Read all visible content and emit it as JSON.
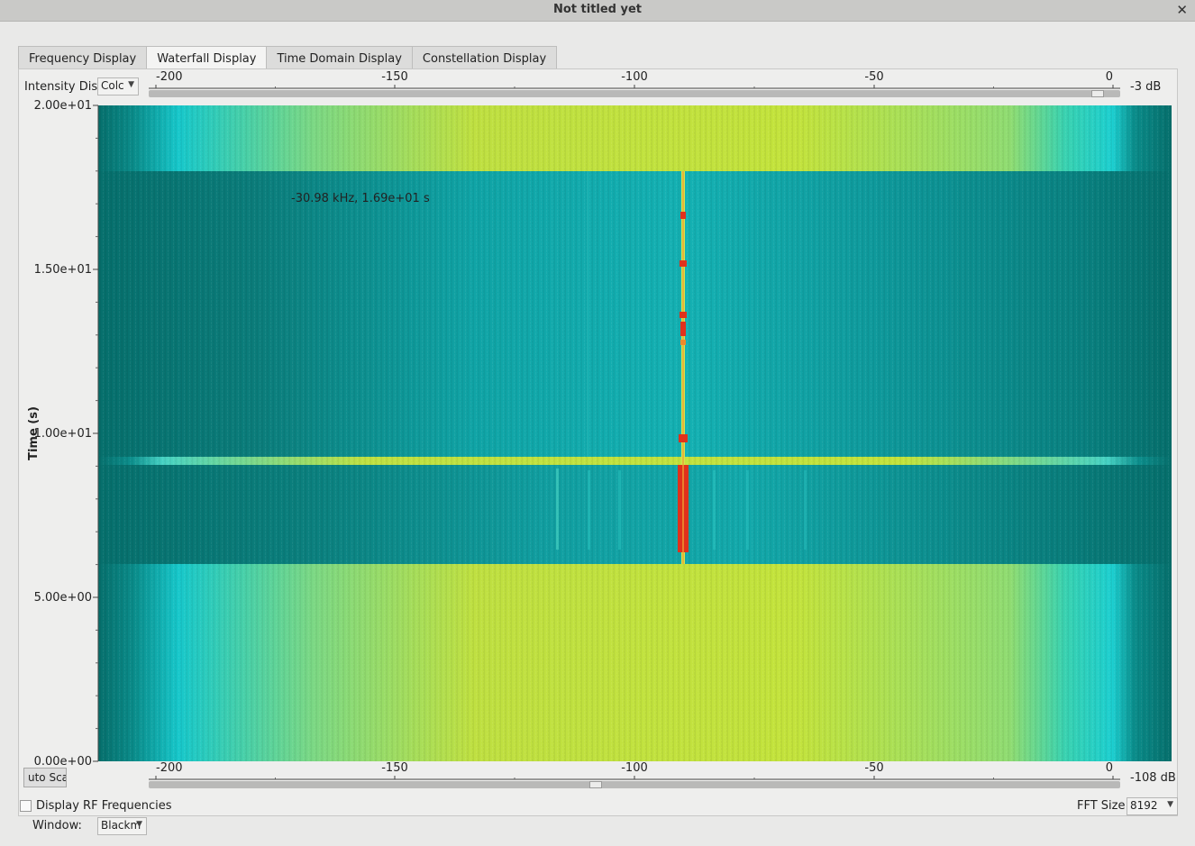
{
  "window": {
    "title": "Not titled yet"
  },
  "tabs": [
    {
      "label": "Frequency Display"
    },
    {
      "label": "Waterfall Display"
    },
    {
      "label": "Time Domain Display"
    },
    {
      "label": "Constellation Display"
    }
  ],
  "toolbar": {
    "intensity_label": "Intensity Disp",
    "intensity_combo": "Colc",
    "max_db": "-3 dB",
    "min_db": "-108 dB",
    "autoscale_label": "uto Scal"
  },
  "x_axis": {
    "ticks": [
      "-200",
      "-150",
      "-100",
      "-50",
      "0"
    ]
  },
  "y_axis": {
    "label": "Time (s)",
    "ticks": [
      "2.00e+01",
      "1.50e+01",
      "1.00e+01",
      "5.00e+00",
      "0.00e+00"
    ]
  },
  "marker_readout": "-30.98 kHz, 1.69e+01 s",
  "bottom": {
    "rf_label": "Display RF Frequencies",
    "window_label": "Window:",
    "window_combo": "Blackm",
    "fft_label": "FFT Size:",
    "fft_value": "8192"
  },
  "colors": {
    "low": "#066f6c",
    "mid": "#18c3c6",
    "high": "#c6e43c",
    "peak": "#e0311c"
  },
  "chart_data": {
    "type": "heatmap",
    "x_range": [
      -200,
      0
    ],
    "y_range": [
      0,
      20
    ],
    "ylabel": "Time (s)",
    "colorbar_range_db": [
      -108,
      -3
    ]
  }
}
